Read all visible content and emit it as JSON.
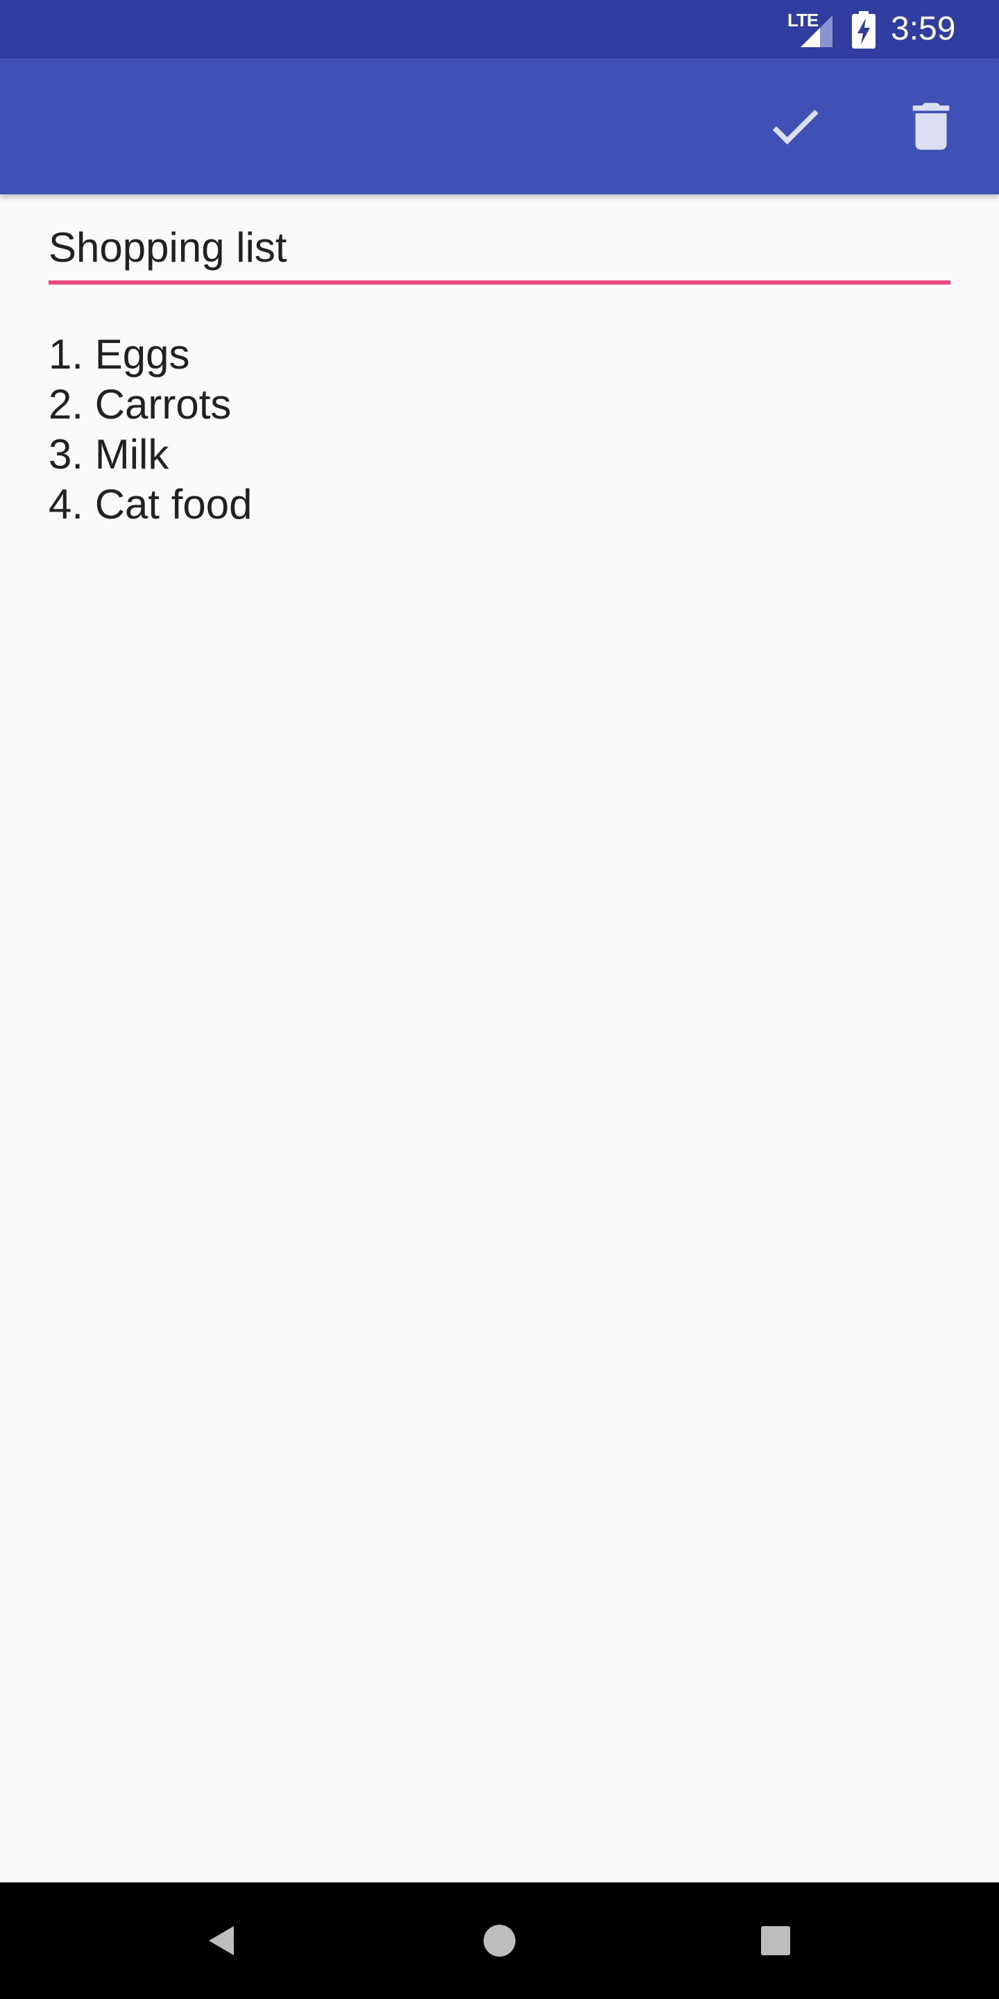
{
  "status_bar": {
    "network_label": "LTE",
    "time": "3:59",
    "icons": [
      "signal-icon",
      "battery-charging-icon"
    ]
  },
  "toolbar": {
    "background": "#3f51b5",
    "status_background": "#2f3d9f",
    "actions": [
      {
        "name": "save",
        "icon": "checkmark-icon"
      },
      {
        "name": "delete",
        "icon": "trash-icon"
      }
    ]
  },
  "note": {
    "title": "Shopping list",
    "underline_color": "#e94b7e",
    "body_lines": [
      "1. Eggs",
      "2. Carrots",
      "3. Milk",
      "4. Cat food"
    ]
  },
  "nav_bar": {
    "icons": [
      "back-icon",
      "home-icon",
      "recents-icon"
    ]
  }
}
